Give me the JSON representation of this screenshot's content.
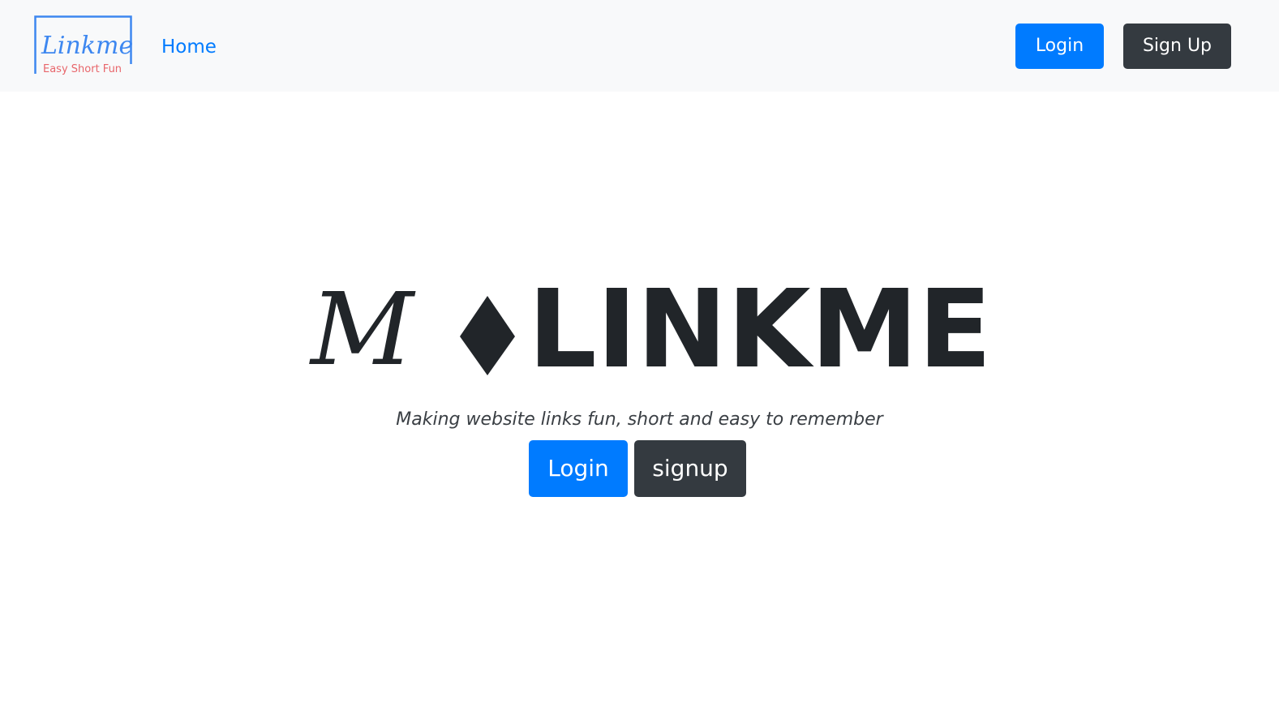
{
  "navbar": {
    "brand": {
      "name": "Linkme",
      "tagline": "Easy Short Fun"
    },
    "home_label": "Home",
    "login_label": "Login",
    "signup_label": "Sign Up"
  },
  "hero": {
    "logo_letter": "M",
    "logo_word": "LINKME",
    "tagline": "Making website links fun, short and easy to remember",
    "login_label": "Login",
    "signup_label": "signup"
  },
  "colors": {
    "primary": "#007bff",
    "dark": "#343a40",
    "navbar_bg": "#f8f9fa",
    "brand_blue": "#3d87f0",
    "brand_red": "#e8666b",
    "text_dark": "#212529"
  }
}
